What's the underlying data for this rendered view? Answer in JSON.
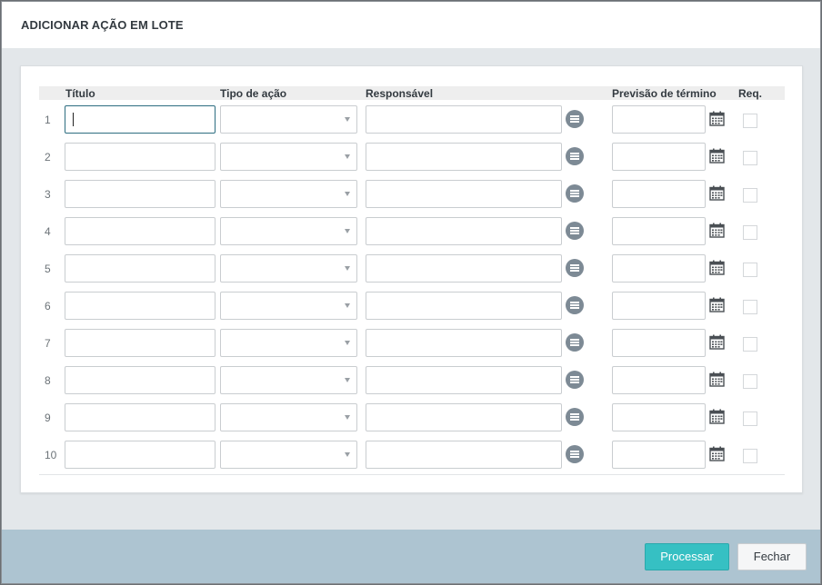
{
  "modal": {
    "title": "ADICIONAR AÇÃO EM LOTE"
  },
  "table": {
    "headers": {
      "titulo": "Título",
      "tipo": "Tipo de ação",
      "responsavel": "Responsável",
      "previsao": "Previsão de término",
      "req": "Req."
    },
    "rows": [
      {
        "num": "1",
        "titulo": "",
        "tipo": "",
        "responsavel": "",
        "previsao": "",
        "req": false
      },
      {
        "num": "2",
        "titulo": "",
        "tipo": "",
        "responsavel": "",
        "previsao": "",
        "req": false
      },
      {
        "num": "3",
        "titulo": "",
        "tipo": "",
        "responsavel": "",
        "previsao": "",
        "req": false
      },
      {
        "num": "4",
        "titulo": "",
        "tipo": "",
        "responsavel": "",
        "previsao": "",
        "req": false
      },
      {
        "num": "5",
        "titulo": "",
        "tipo": "",
        "responsavel": "",
        "previsao": "",
        "req": false
      },
      {
        "num": "6",
        "titulo": "",
        "tipo": "",
        "responsavel": "",
        "previsao": "",
        "req": false
      },
      {
        "num": "7",
        "titulo": "",
        "tipo": "",
        "responsavel": "",
        "previsao": "",
        "req": false
      },
      {
        "num": "8",
        "titulo": "",
        "tipo": "",
        "responsavel": "",
        "previsao": "",
        "req": false
      },
      {
        "num": "9",
        "titulo": "",
        "tipo": "",
        "responsavel": "",
        "previsao": "",
        "req": false
      },
      {
        "num": "10",
        "titulo": "",
        "tipo": "",
        "responsavel": "",
        "previsao": "",
        "req": false
      }
    ],
    "icons": {
      "responsavel": "list-icon",
      "previsao": "calendar-icon"
    }
  },
  "footer": {
    "process_label": "Processar",
    "close_label": "Fechar"
  },
  "colors": {
    "primary": "#36c0c3",
    "footer_bg": "#adc4d1",
    "icon_bg": "#7d8a95"
  }
}
